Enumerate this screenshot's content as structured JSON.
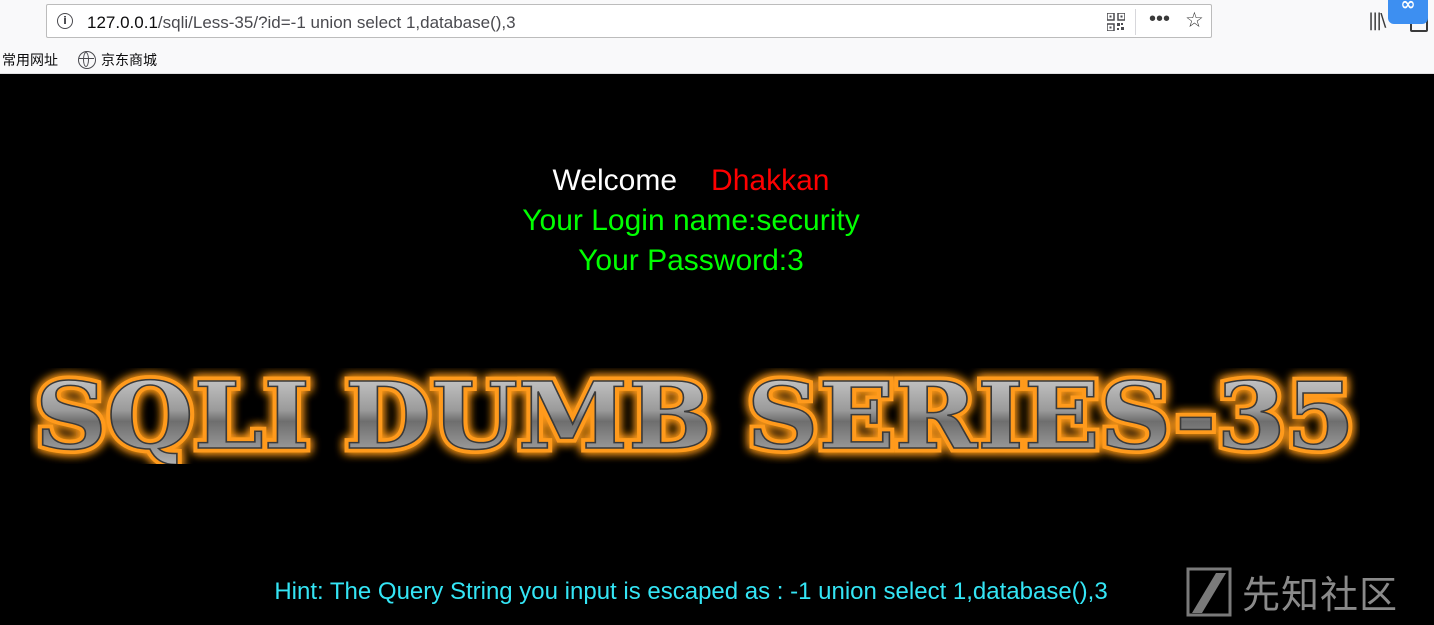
{
  "browser": {
    "url_host": "127.0.0.1",
    "url_path": "/sqli/Less-35/?id=-1 union select 1,database(),3",
    "icons": [
      "info-icon",
      "qr-code-icon",
      "more-icon",
      "star-icon",
      "library-icon",
      "extension-icon",
      "sidebar-icon"
    ],
    "ext_badge": "∞",
    "bookmarks": [
      {
        "label": "常用网址",
        "icon": ""
      },
      {
        "label": "京东商城",
        "icon": "globe-icon"
      }
    ]
  },
  "page": {
    "welcome_word": "Welcome",
    "welcome_name": "Dhakkan",
    "login_line": "Your Login name:security",
    "password_line": "Your Password:3",
    "banner_title": "SQLI DUMB SERIES-35",
    "hint": "Hint: The Query String you input is escaped as : -1 union select 1,database(),3"
  },
  "watermark": {
    "text": "先知社区"
  },
  "colors": {
    "page_bg": "#000000",
    "welcome": "#ffffff",
    "name": "#ff0000",
    "green": "#00ff00",
    "hint": "#34e5f5",
    "banner_glow": "#ff8c00"
  }
}
